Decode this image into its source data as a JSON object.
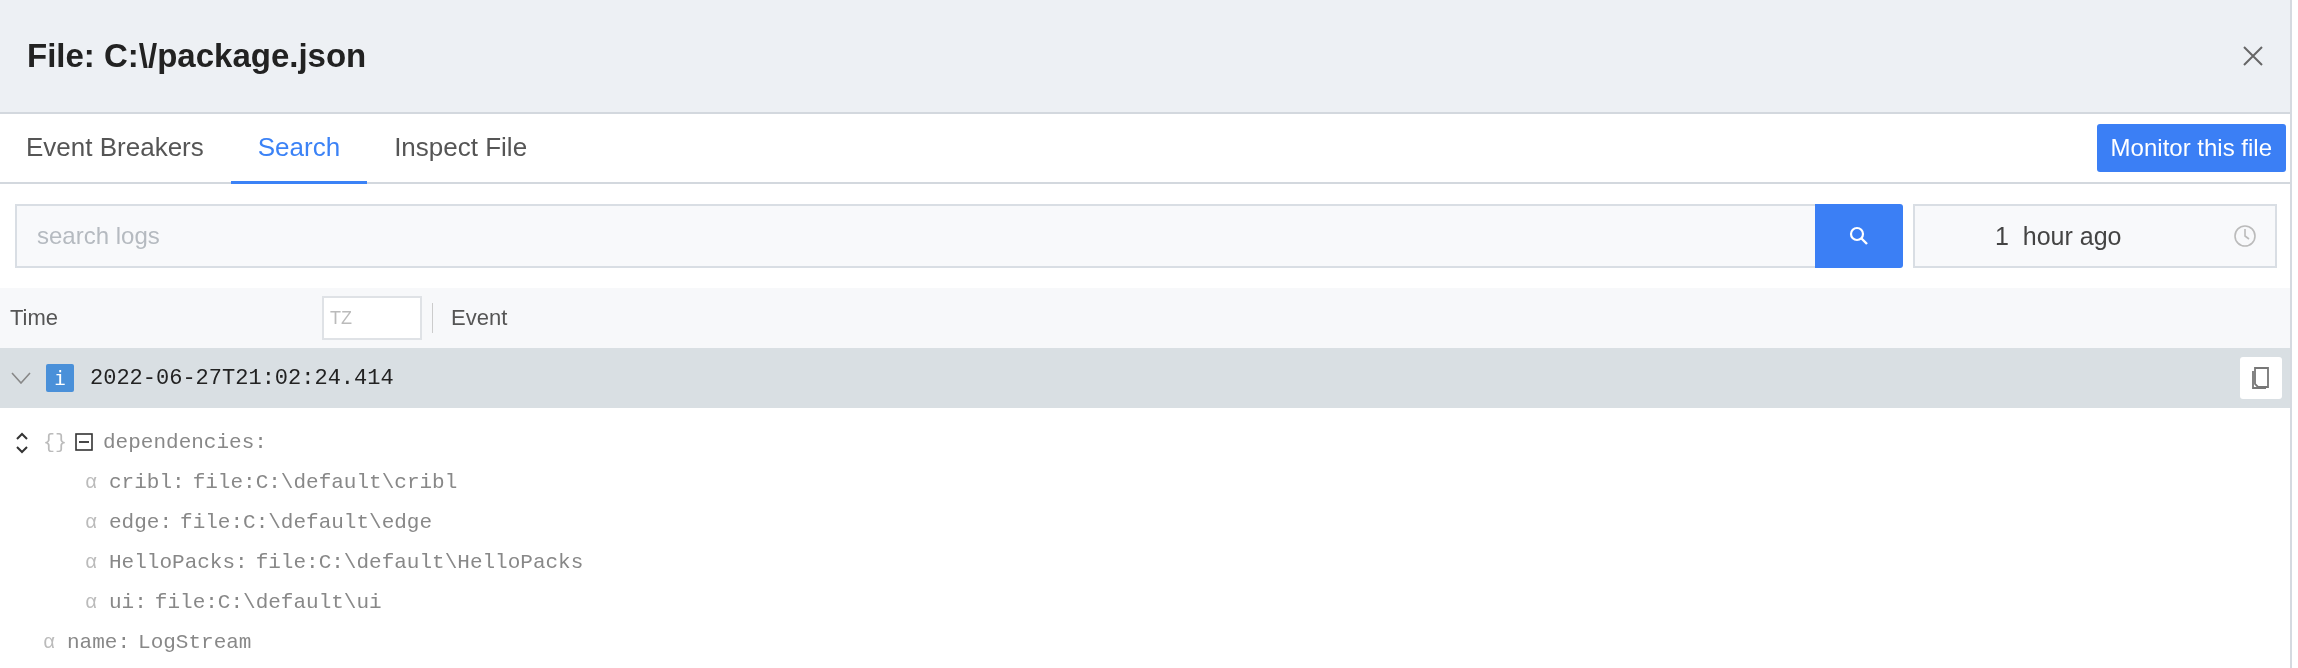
{
  "window": {
    "title": "File: C:\\/package.json"
  },
  "tabs": [
    {
      "label": "Event Breakers",
      "selected": false
    },
    {
      "label": "Search",
      "selected": true
    },
    {
      "label": "Inspect File",
      "selected": false
    }
  ],
  "monitor_button": {
    "label": "Monitor this file"
  },
  "search": {
    "placeholder": "search logs"
  },
  "time_range": {
    "value": "1  hour ago"
  },
  "table": {
    "columns": [
      {
        "label": "Time"
      },
      {
        "label": "Event"
      }
    ],
    "tz_field": {
      "placeholder": "TZ"
    }
  },
  "event": {
    "expanded": true,
    "badge": "i",
    "timestamp": "2022-06-27T21:02:24.414",
    "fields": [
      {
        "kind": "object",
        "glyph": "{}",
        "key": "dependencies:",
        "expanded": true,
        "children": [
          {
            "kind": "string",
            "glyph": "α",
            "key": "cribl:",
            "value": "file:C:\\default\\cribl"
          },
          {
            "kind": "string",
            "glyph": "α",
            "key": "edge:",
            "value": "file:C:\\default\\edge"
          },
          {
            "kind": "string",
            "glyph": "α",
            "key": "HelloPacks:",
            "value": "file:C:\\default\\HelloPacks"
          },
          {
            "kind": "string",
            "glyph": "α",
            "key": "ui:",
            "value": "file:C:\\default\\ui"
          }
        ]
      },
      {
        "kind": "string",
        "glyph": "α",
        "key": "name:",
        "value": "LogStream"
      }
    ]
  }
}
